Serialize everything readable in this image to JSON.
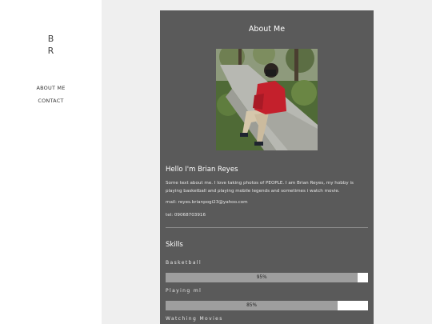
{
  "sidebar": {
    "logo_line1": "B",
    "logo_line2": "R",
    "nav": [
      {
        "label": "ABOUT ME"
      },
      {
        "label": "CONTACT"
      }
    ]
  },
  "card": {
    "title": "About Me",
    "greeting": "Hello I'm Brian Reyes",
    "about": "Some text about me. I love taking photos of PEOPLE. I am Brian Reyes, my hobby is playing basketball and playing mobile legends and sometimes i watch movie.",
    "mail": "mail: reyes.brianpogi23@yahoo.com",
    "tel": "tel: 09068703916",
    "skills_title": "Skills",
    "skills": [
      {
        "name": "Basketball",
        "percent_label": "95%",
        "level": 0.95
      },
      {
        "name": "Playing ml",
        "percent_label": "85%",
        "level": 0.85
      },
      {
        "name": "Watching Movies"
      }
    ]
  },
  "colors": {
    "card_background": "#5a5a5a",
    "page_background": "#efefef",
    "bar_fill": "#9e9e9e",
    "bar_track": "#ffffff"
  }
}
